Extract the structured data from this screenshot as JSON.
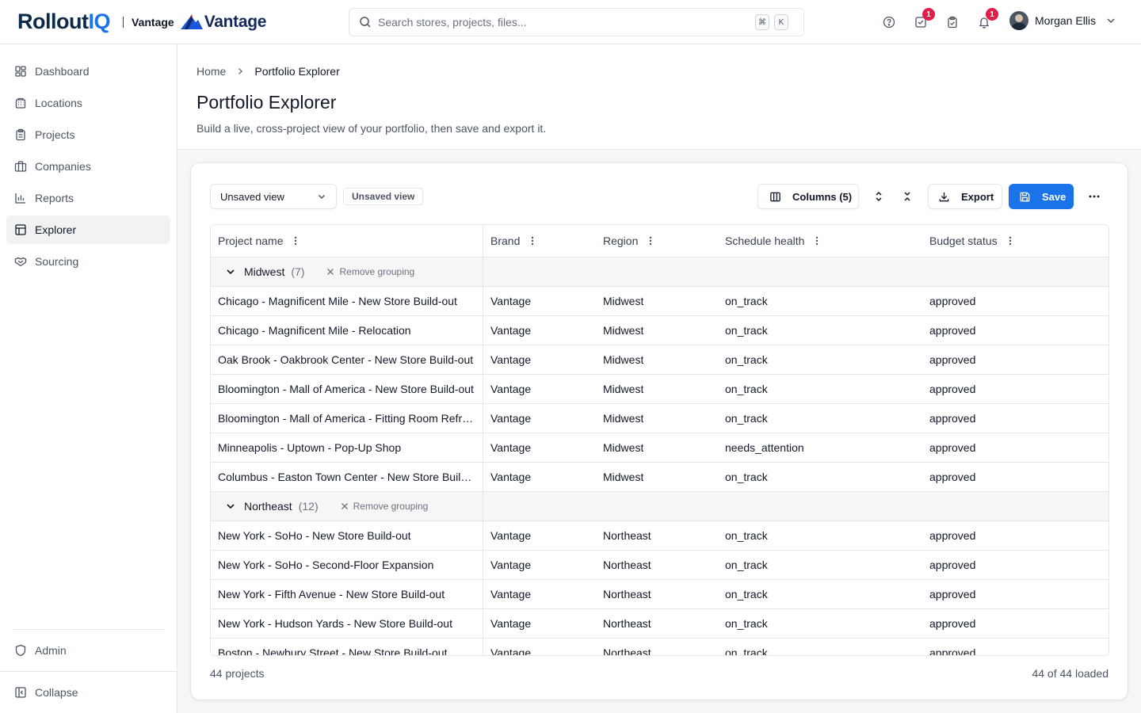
{
  "brand": {
    "logo_main": "Rollout",
    "logo_accent": "IQ",
    "tenant": "Vantage",
    "tenant_logo": "Vantage"
  },
  "search": {
    "placeholder": "Search stores, projects, files...",
    "kbd_1": "⌘",
    "kbd_2": "K"
  },
  "header_icons": {
    "tasks_badge": "1",
    "notifications_badge": "1"
  },
  "user": {
    "name": "Morgan Ellis"
  },
  "sidebar": {
    "items": [
      {
        "label": "Dashboard",
        "icon": "dashboard-icon"
      },
      {
        "label": "Locations",
        "icon": "building-icon"
      },
      {
        "label": "Projects",
        "icon": "clipboard-icon"
      },
      {
        "label": "Companies",
        "icon": "briefcase-icon"
      },
      {
        "label": "Reports",
        "icon": "bar-chart-icon"
      },
      {
        "label": "Explorer",
        "icon": "table-icon",
        "active": true
      },
      {
        "label": "Sourcing",
        "icon": "handshake-icon"
      }
    ],
    "admin": "Admin",
    "collapse": "Collapse"
  },
  "breadcrumb": {
    "home": "Home",
    "current": "Portfolio Explorer"
  },
  "page": {
    "title": "Portfolio Explorer",
    "subtitle": "Build a live, cross-project view of your portfolio, then save and export it."
  },
  "toolbar": {
    "view_select": "Unsaved view",
    "view_pill": "Unsaved view",
    "columns": "Columns (5)",
    "export": "Export",
    "save": "Save"
  },
  "columns": [
    "Project name",
    "Brand",
    "Region",
    "Schedule health",
    "Budget status"
  ],
  "groups": [
    {
      "label": "Midwest",
      "count": "(7)",
      "remove": "Remove grouping",
      "rows": [
        [
          "Chicago - Magnificent Mile - New Store Build-out",
          "Vantage",
          "Midwest",
          "on_track",
          "approved"
        ],
        [
          "Chicago - Magnificent Mile - Relocation",
          "Vantage",
          "Midwest",
          "on_track",
          "approved"
        ],
        [
          "Oak Brook - Oakbrook Center - New Store Build-out",
          "Vantage",
          "Midwest",
          "on_track",
          "approved"
        ],
        [
          "Bloomington - Mall of America - New Store Build-out",
          "Vantage",
          "Midwest",
          "on_track",
          "approved"
        ],
        [
          "Bloomington - Mall of America - Fitting Room Refresh",
          "Vantage",
          "Midwest",
          "on_track",
          "approved"
        ],
        [
          "Minneapolis - Uptown - Pop-Up Shop",
          "Vantage",
          "Midwest",
          "needs_attention",
          "approved"
        ],
        [
          "Columbus - Easton Town Center - New Store Build-out",
          "Vantage",
          "Midwest",
          "on_track",
          "approved"
        ]
      ]
    },
    {
      "label": "Northeast",
      "count": "(12)",
      "remove": "Remove grouping",
      "rows": [
        [
          "New York - SoHo - New Store Build-out",
          "Vantage",
          "Northeast",
          "on_track",
          "approved"
        ],
        [
          "New York - SoHo - Second-Floor Expansion",
          "Vantage",
          "Northeast",
          "on_track",
          "approved"
        ],
        [
          "New York - Fifth Avenue - New Store Build-out",
          "Vantage",
          "Northeast",
          "on_track",
          "approved"
        ],
        [
          "New York - Hudson Yards - New Store Build-out",
          "Vantage",
          "Northeast",
          "on_track",
          "approved"
        ],
        [
          "Boston - Newbury Street - New Store Build-out",
          "Vantage",
          "Northeast",
          "on_track",
          "approved"
        ]
      ]
    }
  ],
  "footer": {
    "count": "44 projects",
    "loaded": "44 of 44 loaded"
  }
}
